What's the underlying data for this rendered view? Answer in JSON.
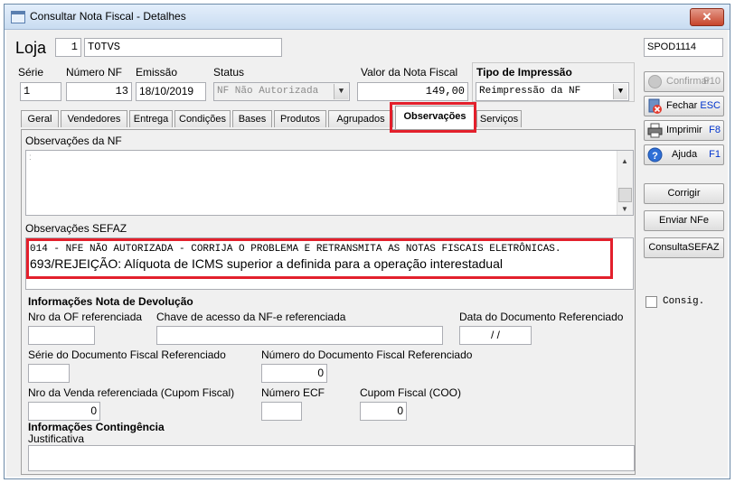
{
  "window": {
    "title": "Consultar Nota Fiscal - Detalhes",
    "close_glyph": "✕"
  },
  "header": {
    "loja_label": "Loja",
    "loja_code": "1",
    "loja_name": "TOTVS",
    "program_code": "SPOD1114"
  },
  "fields": {
    "serie": {
      "label": "Série",
      "value": "1"
    },
    "numero_nf": {
      "label": "Número NF",
      "value": "13"
    },
    "emissao": {
      "label": "Emissão",
      "value": "18/10/2019"
    },
    "status": {
      "label": "Status",
      "value": "NF Não Autorizada"
    },
    "valor": {
      "label": "Valor da Nota Fiscal",
      "value": "149,00"
    },
    "tipo_impressao": {
      "label": "Tipo de Impressão",
      "value": "Reimpressão da  NF"
    }
  },
  "side_buttons": {
    "confirmar": {
      "label": "Confirmar",
      "key": "F10",
      "icon": "check-circle-icon"
    },
    "fechar": {
      "label": "Fechar",
      "key": "ESC",
      "icon": "close-door-icon"
    },
    "imprimir": {
      "label": "Imprimir",
      "key": "F8",
      "icon": "printer-icon"
    },
    "ajuda": {
      "label": "Ajuda",
      "key": "F1",
      "icon": "help-icon"
    },
    "corrigir": {
      "label": "Corrigir"
    },
    "enviar_nfe": {
      "label": "Enviar NFe"
    },
    "consulta_sefaz": {
      "label": "ConsultaSEFAZ"
    },
    "consig": {
      "label": "Consig."
    }
  },
  "tabs": [
    "Geral",
    "Vendedores",
    "Entrega",
    "Condições",
    "Bases",
    "Produtos",
    "Agrupados",
    "Observações",
    "Serviços"
  ],
  "active_tab": "Observações",
  "observacoes": {
    "nf_label": "Observações da NF",
    "nf_text": ":",
    "sefaz_label": "Observações SEFAZ",
    "sefaz_line1": "014 - NFE NÃO AUTORIZADA - CORRIJA O PROBLEMA E RETRANSMITA AS NOTAS FISCAIS ELETRÔNICAS.",
    "sefaz_line2": "693/REJEIÇÃO: Alíquota de ICMS superior a definida para a operação interestadual"
  },
  "devolucao": {
    "section_title": "Informações Nota de Devolução",
    "nro_of_label": "Nro da OF referenciada",
    "chave_label": "Chave de acesso da NF-e referenciada",
    "data_doc_label": "Data do Documento Referenciado",
    "data_doc_value": "/   /",
    "serie_doc_label": "Série do Documento Fiscal Referenciado",
    "numero_doc_label": "Número do Documento Fiscal Referenciado",
    "numero_doc_value": "0",
    "nro_venda_label": "Nro da Venda referenciada (Cupom Fiscal)",
    "nro_venda_value": "0",
    "numero_ecf_label": "Número ECF",
    "cupom_label": "Cupom Fiscal (COO)",
    "cupom_value": "0"
  },
  "contingencia": {
    "section_title": "Informações Contingência",
    "justificativa_label": "Justificativa"
  },
  "colors": {
    "highlight": "#e3202c",
    "accent_key": "#0033cc"
  }
}
